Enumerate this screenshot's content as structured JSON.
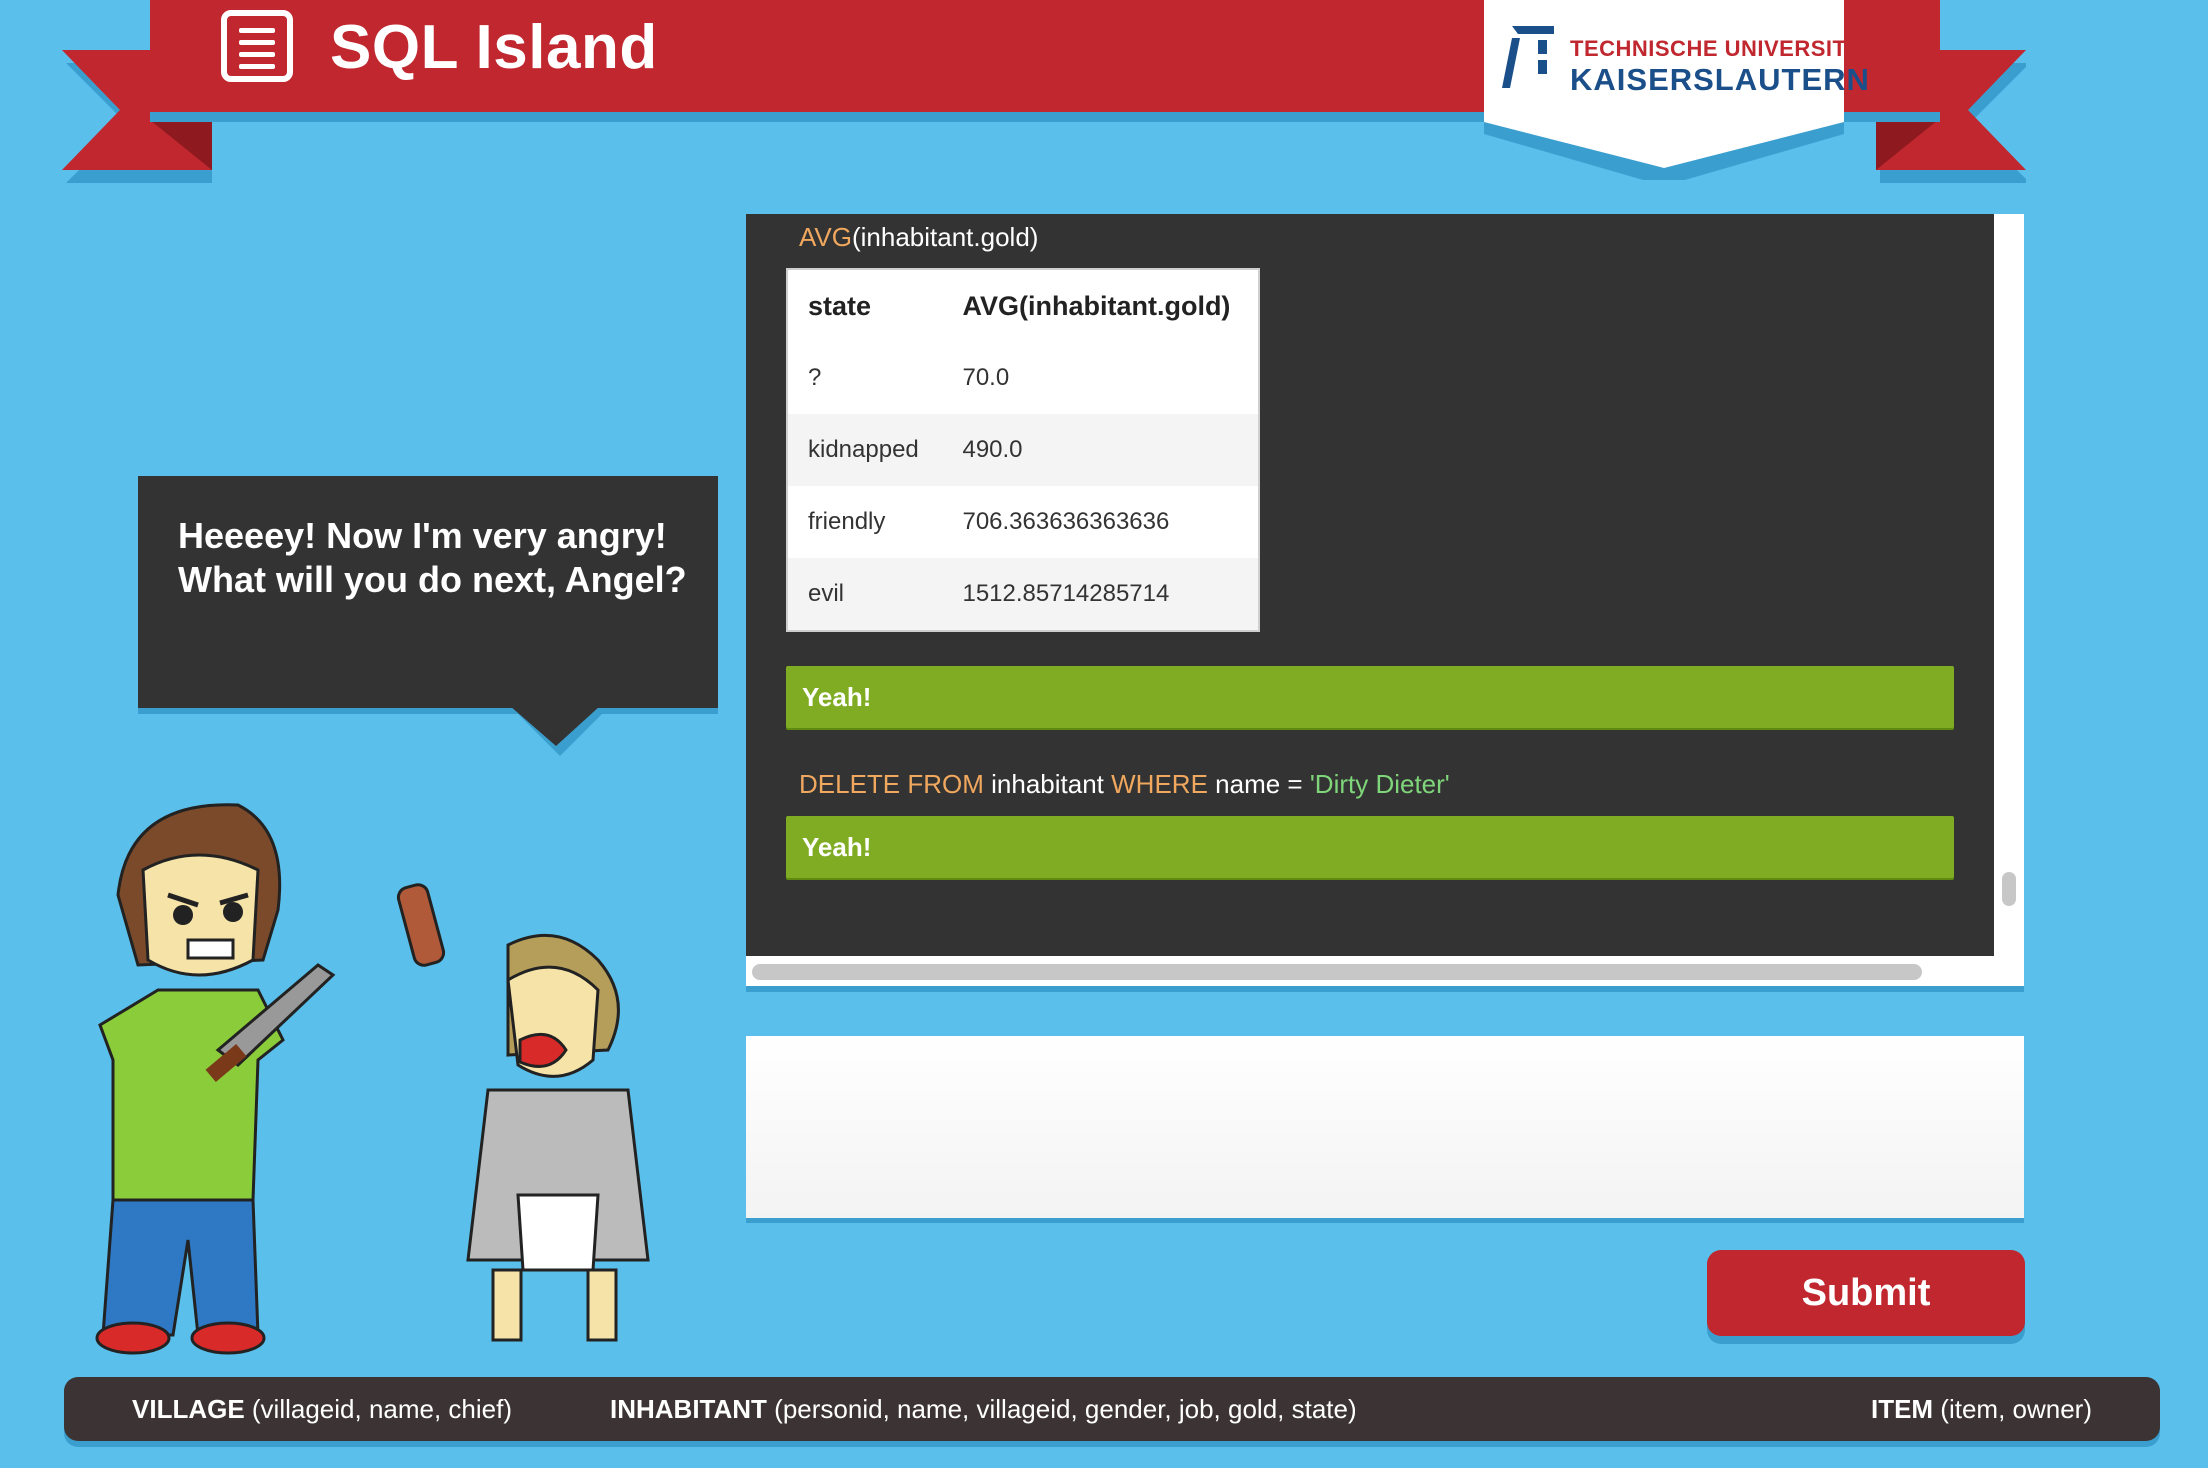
{
  "header": {
    "app_title": "SQL Island",
    "menu_icon": "menu-icon",
    "logo": {
      "line1": "TECHNISCHE UNIVERSITÄT",
      "line2": "KAISERSLAUTERN"
    }
  },
  "dialog": {
    "text": "Heeeey! Now I'm very angry! What will you do next, Angel?"
  },
  "console": {
    "query1_fragment": "AVG(inhabitant.gold)",
    "table": {
      "columns": [
        "state",
        "AVG(inhabitant.gold)"
      ],
      "rows": [
        [
          "?",
          "70.0"
        ],
        [
          "kidnapped",
          "490.0"
        ],
        [
          "friendly",
          "706.363636363636"
        ],
        [
          "evil",
          "1512.85714285714"
        ]
      ]
    },
    "result1": "Yeah!",
    "query2": {
      "kw1": "DELETE FROM",
      "table": " inhabitant ",
      "kw2": "WHERE",
      "cond": " name = ",
      "value": "'Dirty Dieter'"
    },
    "result2": "Yeah!"
  },
  "query_input": {
    "value": "",
    "placeholder": ""
  },
  "submit_label": "Submit",
  "schema": {
    "village_name": "VILLAGE",
    "village_cols": " (villageid, name, chief)",
    "inhabitant_name": "INHABITANT",
    "inhabitant_cols": " (personid, name, villageid, gender, job, gold, state)",
    "item_name": "ITEM",
    "item_cols": " (item, owner)"
  },
  "colors": {
    "background": "#5abfea",
    "banner": "#c0272f",
    "success": "#7fac22",
    "console": "#333333"
  }
}
